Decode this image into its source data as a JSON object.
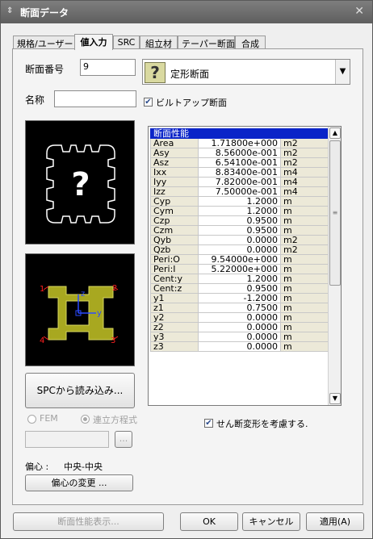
{
  "window": {
    "title": "断面データ",
    "close_glyph": "✕",
    "title_glyph": "⇕"
  },
  "tabs": [
    "規格/ユーザー",
    "値入力",
    "SRC",
    "組立材",
    "テーパー断面",
    "合成"
  ],
  "section_no": {
    "label": "断面番号",
    "value": "9"
  },
  "name": {
    "label": "名称",
    "value": ""
  },
  "shape_combo": {
    "value": "定形断面",
    "icon": "question-mark-icon"
  },
  "builtup": {
    "label": "ビルトアップ断面",
    "checked": true
  },
  "grid": {
    "header": "断面性能",
    "rows": [
      [
        "Area",
        "1.71800e+000",
        "m2"
      ],
      [
        "Asy",
        "8.56000e-001",
        "m2"
      ],
      [
        "Asz",
        "6.54100e-001",
        "m2"
      ],
      [
        "Ixx",
        "8.83400e-001",
        "m4"
      ],
      [
        "Iyy",
        "7.82000e-001",
        "m4"
      ],
      [
        "Izz",
        "7.50000e-001",
        "m4"
      ],
      [
        "Cyp",
        "1.2000",
        "m"
      ],
      [
        "Cym",
        "1.2000",
        "m"
      ],
      [
        "Czp",
        "0.9500",
        "m"
      ],
      [
        "Czm",
        "0.9500",
        "m"
      ],
      [
        "Qyb",
        "0.0000",
        "m2"
      ],
      [
        "Qzb",
        "0.0000",
        "m2"
      ],
      [
        "Peri:O",
        "9.54000e+000",
        "m"
      ],
      [
        "Peri:I",
        "5.22000e+000",
        "m"
      ],
      [
        "Cent:y",
        "1.2000",
        "m"
      ],
      [
        "Cent:z",
        "0.9500",
        "m"
      ],
      [
        "y1",
        "-1.2000",
        "m"
      ],
      [
        "z1",
        "0.7500",
        "m"
      ],
      [
        "y2",
        "0.0000",
        "m"
      ],
      [
        "z2",
        "0.0000",
        "m"
      ],
      [
        "y3",
        "0.0000",
        "m"
      ],
      [
        "z3",
        "0.0000",
        "m"
      ]
    ]
  },
  "section_diagram": {
    "points": [
      "1",
      "2",
      "3",
      "4"
    ],
    "axis_y": "y",
    "axis_z": "z",
    "colors": {
      "shape": "#a8a820",
      "points": "#ff2020",
      "axes": "#2a4aff"
    }
  },
  "spc_button": "SPCから読み込み...",
  "analysis": {
    "fem": "FEM",
    "simul": "連立方程式"
  },
  "file_browse": "...",
  "shear": {
    "label": "せん断変形を考慮する.",
    "checked": true
  },
  "offset": {
    "label": "偏心 :",
    "value": "中央-中央",
    "button": "偏心の変更 ..."
  },
  "footer": {
    "show_props": "断面性能表示...",
    "ok": "OK",
    "cancel": "キャンセル",
    "apply": "適用(A)"
  }
}
